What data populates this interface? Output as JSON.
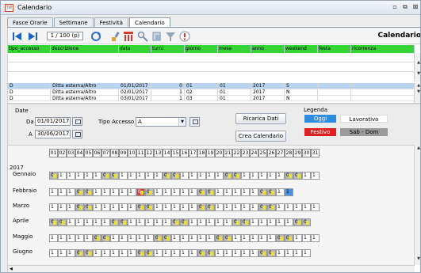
{
  "window": {
    "title": "Calendario",
    "icon_text": "TIP"
  },
  "tabs": [
    {
      "label": "Fasce Orarie"
    },
    {
      "label": "Settimane"
    },
    {
      "label": "Festività"
    },
    {
      "label": "Calendario"
    }
  ],
  "toolbar": {
    "page_indicator": "1 / 100 (p)",
    "section_title": "Calendario"
  },
  "grid": {
    "columns": [
      "tipo_accesso",
      "descrizione",
      "data",
      "turni",
      "giorno",
      "mese",
      "anno",
      "weekend",
      "festa",
      "ricorrenza"
    ],
    "rows": [
      {
        "tipo_accesso": "D",
        "descrizione": "Ditta esterna/Altro",
        "data": "01/01/2017",
        "turni": "0",
        "giorno": "01",
        "mese": "01",
        "anno": "2017",
        "weekend": "S",
        "festa": "",
        "ricorrenza": ""
      },
      {
        "tipo_accesso": "D",
        "descrizione": "Ditta esterna/Altro",
        "data": "02/01/2017",
        "turni": "1",
        "giorno": "02",
        "mese": "01",
        "anno": "2017",
        "weekend": "N",
        "festa": "",
        "ricorrenza": ""
      },
      {
        "tipo_accesso": "D",
        "descrizione": "Ditta esterna/Altro",
        "data": "03/01/2017",
        "turni": "1",
        "giorno": "03",
        "mese": "01",
        "anno": "2017",
        "weekend": "N",
        "festa": "",
        "ricorrenza": ""
      }
    ]
  },
  "filters": {
    "group_label": "Date",
    "da_label": "Da",
    "da_value": "01/01/2017",
    "a_label": "A",
    "a_value": "30/06/2017",
    "tipo_label": "Tipo Accesso",
    "tipo_value": "A",
    "reload_button": "Ricarica Dati",
    "create_button": "Crea Calendario"
  },
  "legend": {
    "title": "Legenda",
    "oggi": "Oggi",
    "lavorativo": "Lavorativo",
    "festivo": "Festivo",
    "sab_dom": "Sab - Dom",
    "colors": {
      "oggi": "#2f8de0",
      "festivo": "#e02020",
      "sab_dom": "#9a9a9a"
    }
  },
  "calendar": {
    "year": "2017",
    "days": [
      "01",
      "02",
      "03",
      "04",
      "05",
      "06",
      "07",
      "08",
      "09",
      "10",
      "11",
      "12",
      "13",
      "14",
      "15",
      "16",
      "17",
      "18",
      "19",
      "20",
      "21",
      "22",
      "23",
      "24",
      "25",
      "26",
      "27",
      "28",
      "29",
      "30",
      "31"
    ],
    "months": [
      {
        "name": "Gennaio",
        "values": [
          "0",
          "1",
          "1",
          "1",
          "1",
          "1",
          "0",
          "0",
          "1",
          "1",
          "1",
          "1",
          "1",
          "0",
          "0",
          "1",
          "1",
          "1",
          "1",
          "1",
          "0",
          "0",
          "1",
          "1",
          "1",
          "1",
          "1",
          "0",
          "0",
          "1",
          "1"
        ]
      },
      {
        "name": "Febbraio",
        "values": [
          "1",
          "1",
          "1",
          "0",
          "0",
          "1",
          "1",
          "1",
          "1",
          "1",
          "0",
          "0",
          "1",
          "1",
          "1",
          "1",
          "1",
          "0",
          "0",
          "1",
          "1",
          "1",
          "1",
          "1",
          "0",
          "0",
          "1",
          "1"
        ]
      },
      {
        "name": "Marzo",
        "values": [
          "1",
          "1",
          "1",
          "0",
          "0",
          "1",
          "1",
          "1",
          "1",
          "1",
          "0",
          "0",
          "1",
          "1",
          "1",
          "1",
          "1",
          "0",
          "0",
          "1",
          "1",
          "1",
          "1",
          "1",
          "0",
          "0",
          "1",
          "1",
          "1",
          "1",
          "1"
        ]
      },
      {
        "name": "Aprile",
        "values": [
          "0",
          "0",
          "1",
          "1",
          "1",
          "1",
          "1",
          "0",
          "0",
          "1",
          "1",
          "1",
          "1",
          "1",
          "0",
          "0",
          "1",
          "1",
          "1",
          "1",
          "1",
          "0",
          "0",
          "1",
          "1",
          "1",
          "1",
          "1",
          "0",
          "0"
        ]
      },
      {
        "name": "Maggio",
        "values": [
          "1",
          "1",
          "1",
          "1",
          "1",
          "0",
          "0",
          "1",
          "1",
          "1",
          "1",
          "1",
          "0",
          "0",
          "1",
          "1",
          "1",
          "1",
          "1",
          "0",
          "0",
          "1",
          "1",
          "1",
          "1",
          "1",
          "0",
          "0",
          "1",
          "1",
          "1"
        ]
      },
      {
        "name": "Giugno",
        "values": [
          "1",
          "1",
          "1",
          "0",
          "0",
          "1",
          "1",
          "1",
          "1",
          "1",
          "0",
          "0",
          "1",
          "1",
          "1",
          "1",
          "1",
          "0",
          "0",
          "1",
          "1",
          "1",
          "1",
          "1",
          "0",
          "0",
          "1",
          "1",
          "1",
          "1"
        ]
      }
    ]
  }
}
